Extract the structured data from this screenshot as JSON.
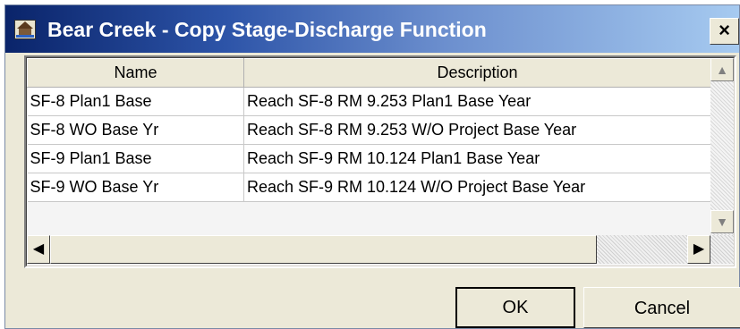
{
  "window": {
    "title": "Bear Creek - Copy Stage-Discharge Function",
    "close_label": "×"
  },
  "table": {
    "columns": [
      "Name",
      "Description"
    ],
    "rows": [
      {
        "name": "SF-8 Plan1 Base",
        "description": "Reach SF-8 RM 9.253 Plan1 Base Year"
      },
      {
        "name": "SF-8 WO Base Yr",
        "description": "Reach SF-8 RM 9.253 W/O Project Base Year"
      },
      {
        "name": "SF-9 Plan1 Base",
        "description": "Reach SF-9 RM  10.124 Plan1 Base Year"
      },
      {
        "name": "SF-9 WO Base Yr",
        "description": "Reach SF-9 RM  10.124 W/O Project Base Year"
      }
    ]
  },
  "scroll": {
    "up": "▲",
    "down": "▼",
    "left": "◀",
    "right": "▶"
  },
  "buttons": {
    "ok": "OK",
    "cancel": "Cancel"
  }
}
